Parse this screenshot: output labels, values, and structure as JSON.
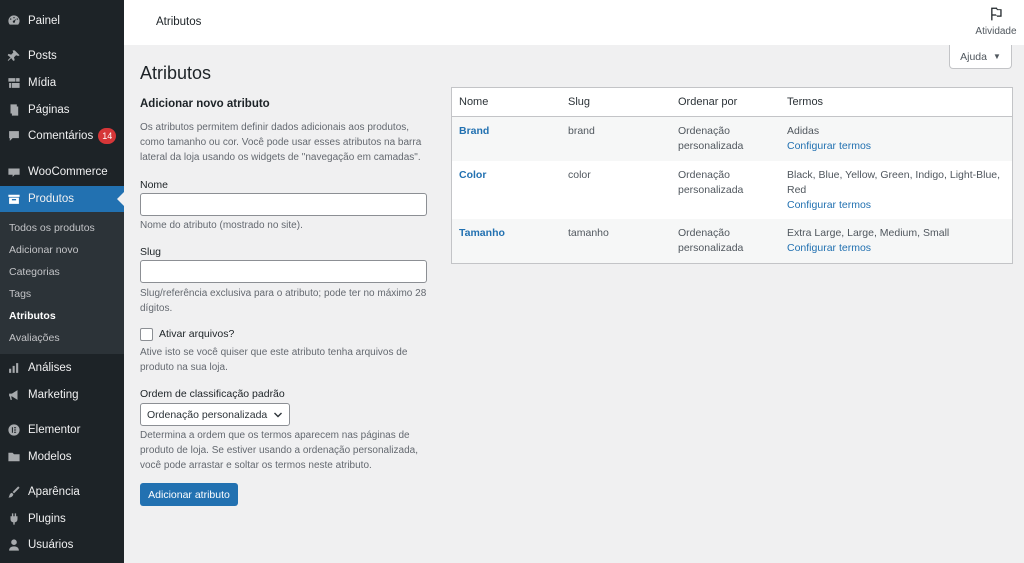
{
  "sidebar": {
    "items": [
      {
        "label": "Painel",
        "icon": "dashboard-icon"
      },
      {
        "label": "Posts",
        "icon": "pin-icon"
      },
      {
        "label": "Mídia",
        "icon": "media-icon"
      },
      {
        "label": "Páginas",
        "icon": "pages-icon"
      },
      {
        "label": "Comentários",
        "icon": "comments-icon",
        "badge": "14"
      },
      {
        "label": "WooCommerce",
        "icon": "woocommerce-icon"
      },
      {
        "label": "Produtos",
        "icon": "products-icon"
      },
      {
        "label": "Análises",
        "icon": "analytics-icon"
      },
      {
        "label": "Marketing",
        "icon": "megaphone-icon"
      },
      {
        "label": "Elementor",
        "icon": "elementor-icon"
      },
      {
        "label": "Modelos",
        "icon": "folder-icon"
      },
      {
        "label": "Aparência",
        "icon": "brush-icon"
      },
      {
        "label": "Plugins",
        "icon": "plugin-icon"
      },
      {
        "label": "Usuários",
        "icon": "user-icon"
      }
    ],
    "submenu": [
      "Todos os produtos",
      "Adicionar novo",
      "Categorias",
      "Tags",
      "Atributos",
      "Avaliações"
    ]
  },
  "topbar": {
    "title": "Atributos",
    "activity_label": "Atividade",
    "help_label": "Ajuda"
  },
  "page": {
    "title": "Atributos"
  },
  "form": {
    "heading": "Adicionar novo atributo",
    "intro": "Os atributos permitem definir dados adicionais aos produtos, como tamanho ou cor. Você pode usar esses atributos na barra lateral da loja usando os widgets de \"navegação em camadas\".",
    "name_label": "Nome",
    "name_help": "Nome do atributo (mostrado no site).",
    "slug_label": "Slug",
    "slug_help": "Slug/referência exclusiva para o atributo; pode ter no máximo 28 dígitos.",
    "archive_label": "Ativar arquivos?",
    "archive_help": "Ative isto se você quiser que este atributo tenha arquivos de produto na sua loja.",
    "order_label": "Ordem de classificação padrão",
    "order_value": "Ordenação personalizada",
    "order_help": "Determina a ordem que os termos aparecem nas páginas de produto de loja. Se estiver usando a ordenação personalizada, você pode arrastar e soltar os termos neste atributo.",
    "submit_label": "Adicionar atributo"
  },
  "table": {
    "headers": [
      "Nome",
      "Slug",
      "Ordenar por",
      "Termos"
    ],
    "rows": [
      {
        "name": "Brand",
        "slug": "brand",
        "order": "Ordenação personalizada",
        "terms": "Adidas",
        "configure": "Configurar termos"
      },
      {
        "name": "Color",
        "slug": "color",
        "order": "Ordenação personalizada",
        "terms": "Black, Blue, Yellow, Green, Indigo, Light-Blue, Red",
        "configure": "Configurar termos"
      },
      {
        "name": "Tamanho",
        "slug": "tamanho",
        "order": "Ordenação personalizada",
        "terms": "Extra Large, Large, Medium, Small",
        "configure": "Configurar termos"
      }
    ]
  },
  "colors": {
    "sidebar_bg": "#1d2327",
    "submenu_bg": "#2c3338",
    "accent": "#2271b1",
    "badge": "#d63638",
    "page_bg": "#f0f0f1"
  }
}
